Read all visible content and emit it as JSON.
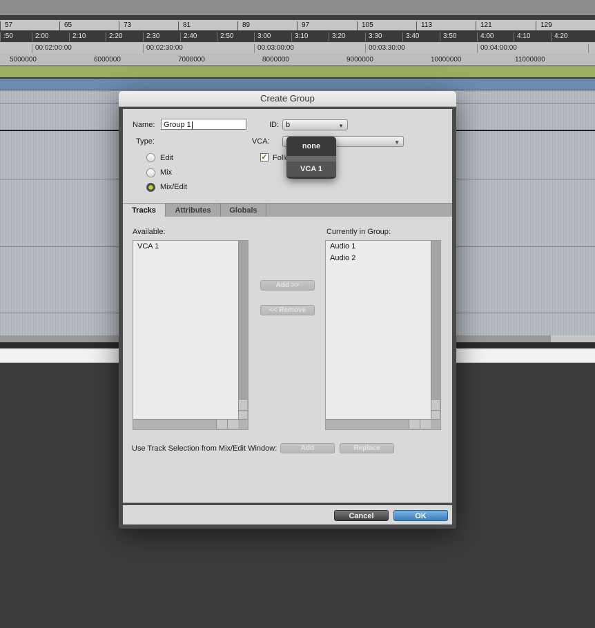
{
  "rulers": {
    "bars": [
      "57",
      "65",
      "73",
      "81",
      "89",
      "97",
      "105",
      "113",
      "121",
      "129"
    ],
    "minsecs": [
      ":50",
      "2:00",
      "2:10",
      "2:20",
      "2:30",
      "2:40",
      "2:50",
      "3:00",
      "3:10",
      "3:20",
      "3:30",
      "3:40",
      "3:50",
      "4:00",
      "4:10",
      "4:20"
    ],
    "timecode": [
      "00:02:00:00",
      "00:02:30:00",
      "00:03:00:00",
      "00:03:30:00",
      "00:04:00:00"
    ],
    "samples": [
      "5000000",
      "6000000",
      "7000000",
      "8000000",
      "9000000",
      "10000000",
      "11000000"
    ]
  },
  "dialog": {
    "title": "Create Group",
    "name_label": "Name:",
    "name_value": "Group 1",
    "id_label": "ID:",
    "id_value": "b",
    "type_label": "Type:",
    "type_options": [
      "Edit",
      "Mix",
      "Mix/Edit"
    ],
    "type_selected": "Mix/Edit",
    "vca_label": "VCA:",
    "follow_label": "Follo",
    "follow_checked": true,
    "tabs": [
      "Tracks",
      "Attributes",
      "Globals"
    ],
    "active_tab": "Tracks",
    "available_label": "Available:",
    "available_items": [
      "VCA 1"
    ],
    "in_group_label": "Currently in Group:",
    "in_group_items": [
      "Audio 1",
      "Audio 2"
    ],
    "add_button": "Add >>",
    "remove_button": "<< Remove",
    "track_selection_label": "Use Track Selection from Mix/Edit Window:",
    "sel_add_button": "Add",
    "sel_replace_button": "Replace",
    "cancel_button": "Cancel",
    "ok_button": "OK"
  },
  "vca_popup": {
    "options": [
      "none",
      "VCA 1"
    ],
    "highlighted": "VCA 1"
  },
  "colors": {
    "radio_selected": "#b6d72b",
    "ok_button": "#3c7fbd",
    "track_lane_green": "#9aaf64",
    "track_lane_blue": "#6c8cb1"
  }
}
